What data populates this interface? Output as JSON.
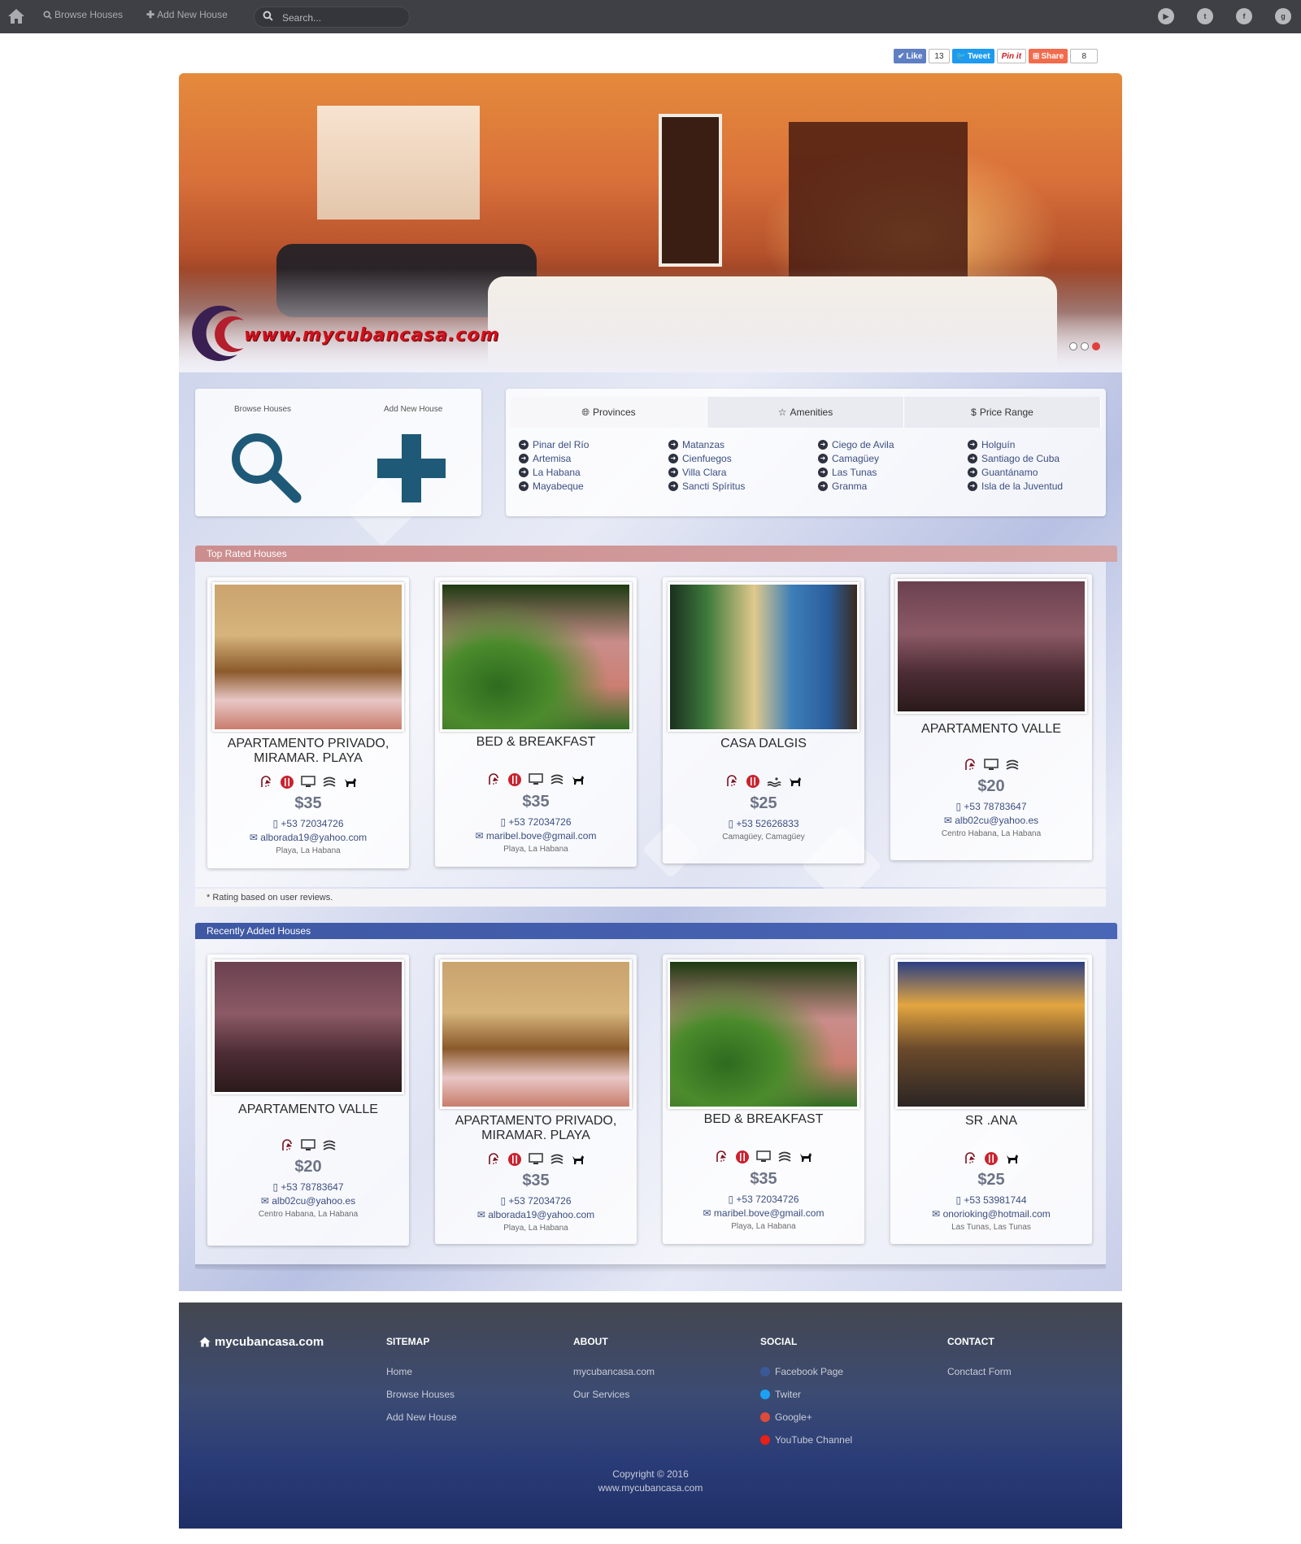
{
  "nav": {
    "browse": "Browse Houses",
    "add": "Add New House",
    "search_placeholder": "Search..."
  },
  "share": {
    "like": "Like",
    "like_count": "13",
    "tweet": "Tweet",
    "pinit": "Pin it",
    "share": "Share",
    "share_count": "8"
  },
  "hero": {
    "logo_text": "www.mycubancasa.com"
  },
  "quick": {
    "browse_label": "Browse Houses",
    "add_label": "Add New House"
  },
  "tabs": [
    "Provinces",
    "Amenities",
    "Price Range"
  ],
  "provinces": [
    [
      "Pinar del Río",
      "Artemisa",
      "La Habana",
      "Mayabeque"
    ],
    [
      "Matanzas",
      "Cienfuegos",
      "Villa Clara",
      "Sancti Spíritus"
    ],
    [
      "Ciego de Avila",
      "Camagüey",
      "Las Tunas",
      "Granma"
    ],
    [
      "Holguín",
      "Santiago de Cuba",
      "Guantánamo",
      "Isla de la Juventud"
    ]
  ],
  "top_rated": {
    "heading": "Top Rated Houses",
    "footnote": "* Rating based on user reviews.",
    "cards": [
      {
        "title": "APARTAMENTO PRIVADO, MIRAMAR. PLAYA",
        "price": "$35",
        "phone": "+53 72034726",
        "email": "alborada19@yahoo.com",
        "location": "Playa, La Habana"
      },
      {
        "title": "BED & BREAKFAST",
        "price": "$35",
        "phone": "+53 72034726",
        "email": "maribel.bove@gmail.com",
        "location": "Playa, La Habana"
      },
      {
        "title": "CASA DALGIS",
        "price": "$25",
        "phone": "+53 52626833",
        "email": "",
        "location": "Camagüey, Camagüey"
      },
      {
        "title": "APARTAMENTO VALLE",
        "price": "$20",
        "phone": "+53 78783647",
        "email": "alb02cu@yahoo.es",
        "location": "Centro Habana, La Habana"
      }
    ]
  },
  "recent": {
    "heading": "Recently Added Houses",
    "cards": [
      {
        "title": "APARTAMENTO VALLE",
        "price": "$20",
        "phone": "+53 78783647",
        "email": "alb02cu@yahoo.es",
        "location": "Centro Habana, La Habana"
      },
      {
        "title": "APARTAMENTO PRIVADO, MIRAMAR. PLAYA",
        "price": "$35",
        "phone": "+53 72034726",
        "email": "alborada19@yahoo.com",
        "location": "Playa, La Habana"
      },
      {
        "title": "BED & BREAKFAST",
        "price": "$35",
        "phone": "+53 72034726",
        "email": "maribel.bove@gmail.com",
        "location": "Playa, La Habana"
      },
      {
        "title": "SR .ANA",
        "price": "$25",
        "phone": "+53 53981744",
        "email": "onorioking@hotmail.com",
        "location": "Las Tunas, Las Tunas"
      }
    ]
  },
  "footer": {
    "brand": "mycubancasa.com",
    "sitemap": {
      "heading": "SITEMAP",
      "links": [
        "Home",
        "Browse Houses",
        "Add New House"
      ]
    },
    "about": {
      "heading": "ABOUT",
      "links": [
        "mycubancasa.com",
        "Our Services"
      ]
    },
    "social": {
      "heading": "SOCIAL",
      "links": [
        "Facebook Page",
        "Twiter",
        "Google+",
        "YouTube Channel"
      ]
    },
    "contact": {
      "heading": "CONTACT",
      "links": [
        "Conctact Form"
      ]
    },
    "copyright": "Copyright © 2016",
    "site": "www.mycubancasa.com"
  }
}
